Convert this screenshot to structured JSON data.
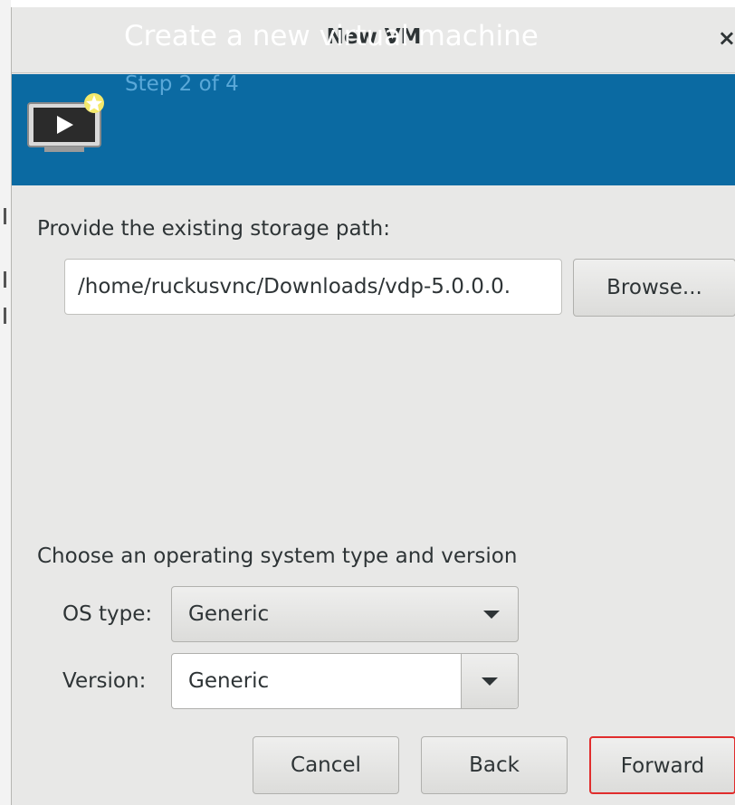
{
  "window": {
    "title": "New VM",
    "close_glyph": "×"
  },
  "banner": {
    "icon": "virtual-machine-icon",
    "title": "Create a new virtual machine",
    "step": "Step 2 of 4",
    "background_color": "#0b6aa2"
  },
  "storage": {
    "label": "Provide the existing storage path:",
    "path_value": "/home/ruckusvnc/Downloads/vdp-5.0.0.0.",
    "browse_label": "Browse..."
  },
  "os": {
    "section_label": "Choose an operating system type and version",
    "type_label": "OS type:",
    "type_value": "Generic",
    "version_label": "Version:",
    "version_value": "Generic"
  },
  "actions": {
    "cancel_label": "Cancel",
    "back_label": "Back",
    "forward_label": "Forward",
    "highlight_color": "#e02d2d"
  }
}
